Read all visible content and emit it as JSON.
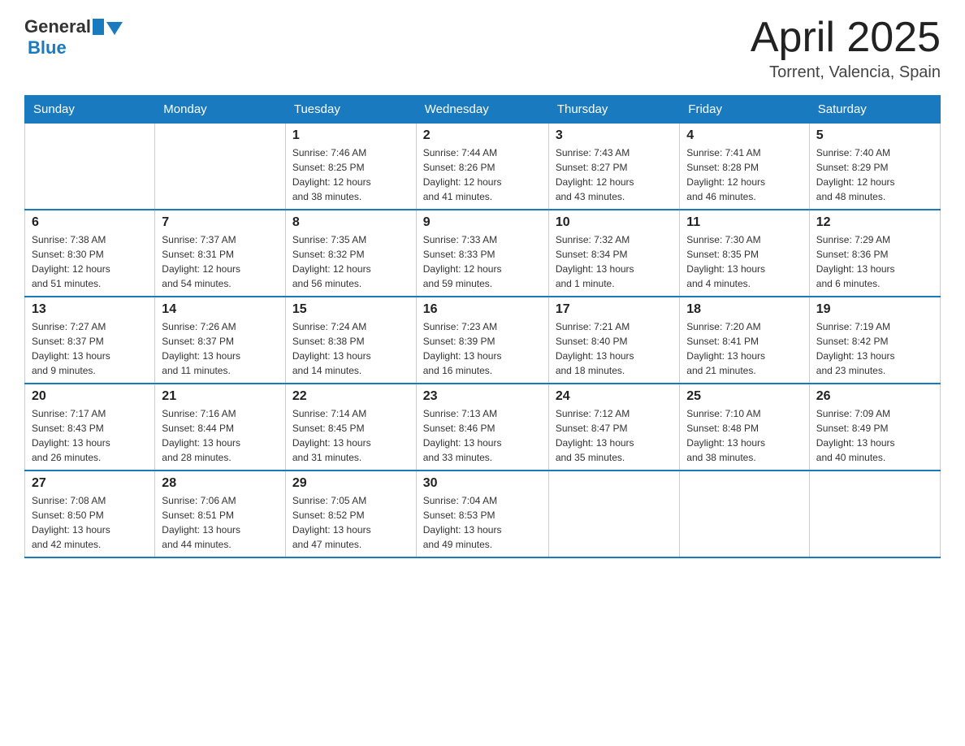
{
  "header": {
    "logo_general": "General",
    "logo_blue": "Blue",
    "month_title": "April 2025",
    "location": "Torrent, Valencia, Spain"
  },
  "weekdays": [
    "Sunday",
    "Monday",
    "Tuesday",
    "Wednesday",
    "Thursday",
    "Friday",
    "Saturday"
  ],
  "weeks": [
    [
      {
        "day": "",
        "info": ""
      },
      {
        "day": "",
        "info": ""
      },
      {
        "day": "1",
        "info": "Sunrise: 7:46 AM\nSunset: 8:25 PM\nDaylight: 12 hours\nand 38 minutes."
      },
      {
        "day": "2",
        "info": "Sunrise: 7:44 AM\nSunset: 8:26 PM\nDaylight: 12 hours\nand 41 minutes."
      },
      {
        "day": "3",
        "info": "Sunrise: 7:43 AM\nSunset: 8:27 PM\nDaylight: 12 hours\nand 43 minutes."
      },
      {
        "day": "4",
        "info": "Sunrise: 7:41 AM\nSunset: 8:28 PM\nDaylight: 12 hours\nand 46 minutes."
      },
      {
        "day": "5",
        "info": "Sunrise: 7:40 AM\nSunset: 8:29 PM\nDaylight: 12 hours\nand 48 minutes."
      }
    ],
    [
      {
        "day": "6",
        "info": "Sunrise: 7:38 AM\nSunset: 8:30 PM\nDaylight: 12 hours\nand 51 minutes."
      },
      {
        "day": "7",
        "info": "Sunrise: 7:37 AM\nSunset: 8:31 PM\nDaylight: 12 hours\nand 54 minutes."
      },
      {
        "day": "8",
        "info": "Sunrise: 7:35 AM\nSunset: 8:32 PM\nDaylight: 12 hours\nand 56 minutes."
      },
      {
        "day": "9",
        "info": "Sunrise: 7:33 AM\nSunset: 8:33 PM\nDaylight: 12 hours\nand 59 minutes."
      },
      {
        "day": "10",
        "info": "Sunrise: 7:32 AM\nSunset: 8:34 PM\nDaylight: 13 hours\nand 1 minute."
      },
      {
        "day": "11",
        "info": "Sunrise: 7:30 AM\nSunset: 8:35 PM\nDaylight: 13 hours\nand 4 minutes."
      },
      {
        "day": "12",
        "info": "Sunrise: 7:29 AM\nSunset: 8:36 PM\nDaylight: 13 hours\nand 6 minutes."
      }
    ],
    [
      {
        "day": "13",
        "info": "Sunrise: 7:27 AM\nSunset: 8:37 PM\nDaylight: 13 hours\nand 9 minutes."
      },
      {
        "day": "14",
        "info": "Sunrise: 7:26 AM\nSunset: 8:37 PM\nDaylight: 13 hours\nand 11 minutes."
      },
      {
        "day": "15",
        "info": "Sunrise: 7:24 AM\nSunset: 8:38 PM\nDaylight: 13 hours\nand 14 minutes."
      },
      {
        "day": "16",
        "info": "Sunrise: 7:23 AM\nSunset: 8:39 PM\nDaylight: 13 hours\nand 16 minutes."
      },
      {
        "day": "17",
        "info": "Sunrise: 7:21 AM\nSunset: 8:40 PM\nDaylight: 13 hours\nand 18 minutes."
      },
      {
        "day": "18",
        "info": "Sunrise: 7:20 AM\nSunset: 8:41 PM\nDaylight: 13 hours\nand 21 minutes."
      },
      {
        "day": "19",
        "info": "Sunrise: 7:19 AM\nSunset: 8:42 PM\nDaylight: 13 hours\nand 23 minutes."
      }
    ],
    [
      {
        "day": "20",
        "info": "Sunrise: 7:17 AM\nSunset: 8:43 PM\nDaylight: 13 hours\nand 26 minutes."
      },
      {
        "day": "21",
        "info": "Sunrise: 7:16 AM\nSunset: 8:44 PM\nDaylight: 13 hours\nand 28 minutes."
      },
      {
        "day": "22",
        "info": "Sunrise: 7:14 AM\nSunset: 8:45 PM\nDaylight: 13 hours\nand 31 minutes."
      },
      {
        "day": "23",
        "info": "Sunrise: 7:13 AM\nSunset: 8:46 PM\nDaylight: 13 hours\nand 33 minutes."
      },
      {
        "day": "24",
        "info": "Sunrise: 7:12 AM\nSunset: 8:47 PM\nDaylight: 13 hours\nand 35 minutes."
      },
      {
        "day": "25",
        "info": "Sunrise: 7:10 AM\nSunset: 8:48 PM\nDaylight: 13 hours\nand 38 minutes."
      },
      {
        "day": "26",
        "info": "Sunrise: 7:09 AM\nSunset: 8:49 PM\nDaylight: 13 hours\nand 40 minutes."
      }
    ],
    [
      {
        "day": "27",
        "info": "Sunrise: 7:08 AM\nSunset: 8:50 PM\nDaylight: 13 hours\nand 42 minutes."
      },
      {
        "day": "28",
        "info": "Sunrise: 7:06 AM\nSunset: 8:51 PM\nDaylight: 13 hours\nand 44 minutes."
      },
      {
        "day": "29",
        "info": "Sunrise: 7:05 AM\nSunset: 8:52 PM\nDaylight: 13 hours\nand 47 minutes."
      },
      {
        "day": "30",
        "info": "Sunrise: 7:04 AM\nSunset: 8:53 PM\nDaylight: 13 hours\nand 49 minutes."
      },
      {
        "day": "",
        "info": ""
      },
      {
        "day": "",
        "info": ""
      },
      {
        "day": "",
        "info": ""
      }
    ]
  ]
}
